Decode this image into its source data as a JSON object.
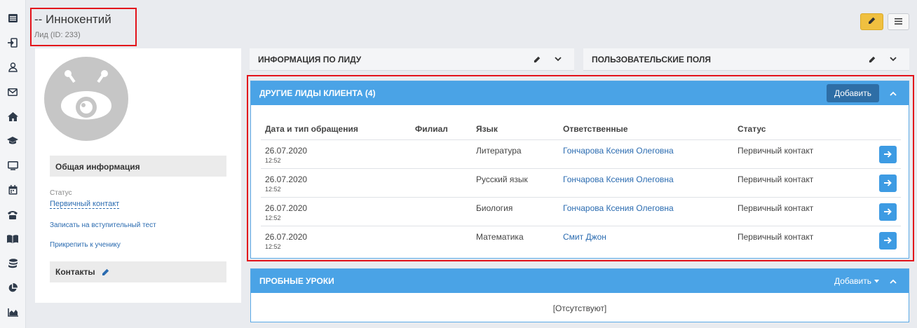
{
  "sidebar": {
    "icons": [
      "list-icon",
      "sign-in-icon",
      "user-icon",
      "envelope-icon",
      "home-icon",
      "graduation-cap-icon",
      "monitor-icon",
      "calendar-icon",
      "phone-icon",
      "book-icon",
      "coins-icon",
      "pie-chart-icon",
      "area-chart-icon"
    ]
  },
  "header": {
    "title": "-- Иннокентий",
    "subtitle": "Лид (ID: 233)"
  },
  "profile": {
    "general_info": "Общая информация",
    "status_label": "Статус",
    "status_value": "Первичный контакт",
    "link_enroll": "Записать на вступительный тест",
    "link_attach": "Прикрепить к ученику",
    "contacts": "Контакты"
  },
  "panels": {
    "lead_info": "ИНФОРМАЦИЯ ПО ЛИДУ",
    "custom_fields": "ПОЛЬЗОВАТЕЛЬСКИЕ ПОЛЯ"
  },
  "other_leads": {
    "title": "ДРУГИЕ ЛИДЫ КЛИЕНТА (4)",
    "add_label": "Добавить",
    "columns": [
      "Дата и тип обращения",
      "Филиал",
      "Язык",
      "Ответственные",
      "Статус"
    ],
    "rows": [
      {
        "date": "26.07.2020",
        "time": "12:52",
        "branch": "",
        "language": "Литература",
        "responsible": "Гончарова Ксения Олеговна",
        "status": "Первичный контакт"
      },
      {
        "date": "26.07.2020",
        "time": "12:52",
        "branch": "",
        "language": "Русский язык",
        "responsible": "Гончарова Ксения Олеговна",
        "status": "Первичный контакт"
      },
      {
        "date": "26.07.2020",
        "time": "12:52",
        "branch": "",
        "language": "Биология",
        "responsible": "Гончарова Ксения Олеговна",
        "status": "Первичный контакт"
      },
      {
        "date": "26.07.2020",
        "time": "12:52",
        "branch": "",
        "language": "Математика",
        "responsible": "Смит Джон",
        "status": "Первичный контакт"
      }
    ]
  },
  "trial_lessons": {
    "title": "ПРОБНЫЕ УРОКИ",
    "add_label": "Добавить",
    "empty": "[Отсутствуют]"
  },
  "colors": {
    "accent_blue": "#4aa3e6",
    "dark_blue_button": "#2e6ea6",
    "edit_yellow": "#f0c040",
    "highlight_red": "#e3131b"
  }
}
